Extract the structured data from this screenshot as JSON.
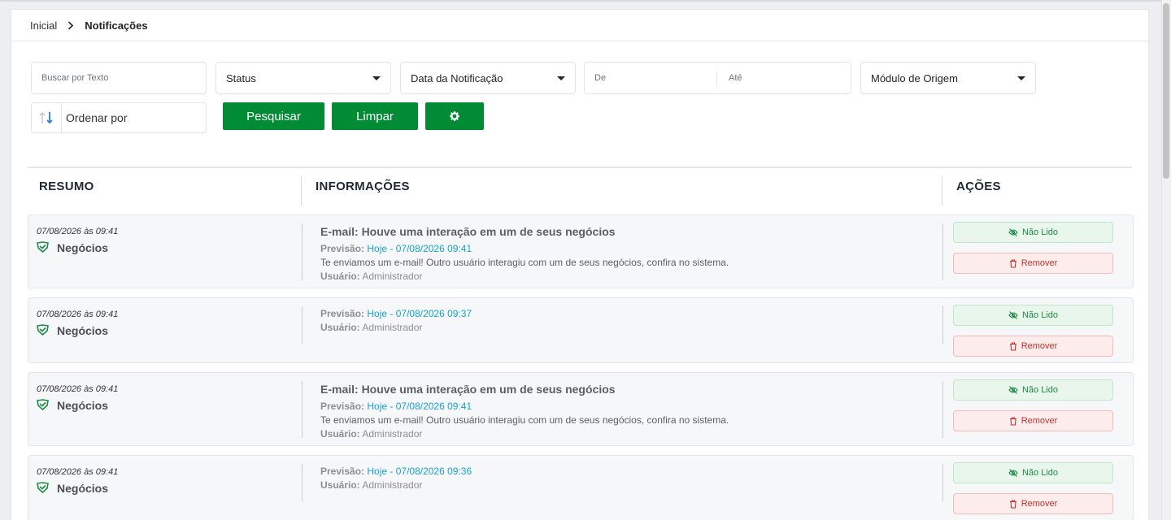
{
  "breadcrumb": {
    "home": "Inicial",
    "current": "Notificações"
  },
  "filters": {
    "search_placeholder": "Buscar por Texto",
    "status": "Status",
    "date_type": "Data da Notificação",
    "date_from": "De",
    "date_to": "Até",
    "module": "Módulo de Origem",
    "order_by": "Ordenar por"
  },
  "buttons": {
    "search": "Pesquisar",
    "clear": "Limpar"
  },
  "columns": {
    "summary": "RESUMO",
    "info": "INFORMAÇÕES",
    "actions": "AÇÕES"
  },
  "actions": {
    "unread": "Não Lido",
    "remove": "Remover"
  },
  "labels": {
    "forecast": "Previsão:",
    "user": "Usuário:"
  },
  "notifications": [
    {
      "date": "07/08/2026 às 09:41",
      "module": "Negócios",
      "title": "E-mail: Houve uma interação em um de seus negócios",
      "forecast": "Hoje - 07/08/2026 09:41",
      "message": "Te enviamos um e-mail! Outro usuário interagiu com um de seus negócios, confira no sistema.",
      "user": "Administrador"
    },
    {
      "date": "07/08/2026 às 09:41",
      "module": "Negócios",
      "forecast": "Hoje - 07/08/2026 09:37",
      "user": "Administrador"
    },
    {
      "date": "07/08/2026 às 09:41",
      "module": "Negócios",
      "title": "E-mail: Houve uma interação em um de seus negócios",
      "forecast": "Hoje - 07/08/2026 09:41",
      "message": "Te enviamos um e-mail! Outro usuário interagiu com um de seus negócios, confira no sistema.",
      "user": "Administrador"
    },
    {
      "date": "07/08/2026 às 09:41",
      "module": "Negócios",
      "forecast": "Hoje - 07/08/2026 09:36",
      "user": "Administrador"
    }
  ],
  "colors": {
    "primary": "#008b34",
    "link": "#18a2cf",
    "unread_bg": "#e8f6ec",
    "remove_bg": "#fdecec"
  },
  "icons": {
    "module": "handshake-icon",
    "unread": "eye-slash-icon",
    "remove": "trash-icon",
    "settings": "gear-icon",
    "sort": "sort-arrows-icon"
  }
}
